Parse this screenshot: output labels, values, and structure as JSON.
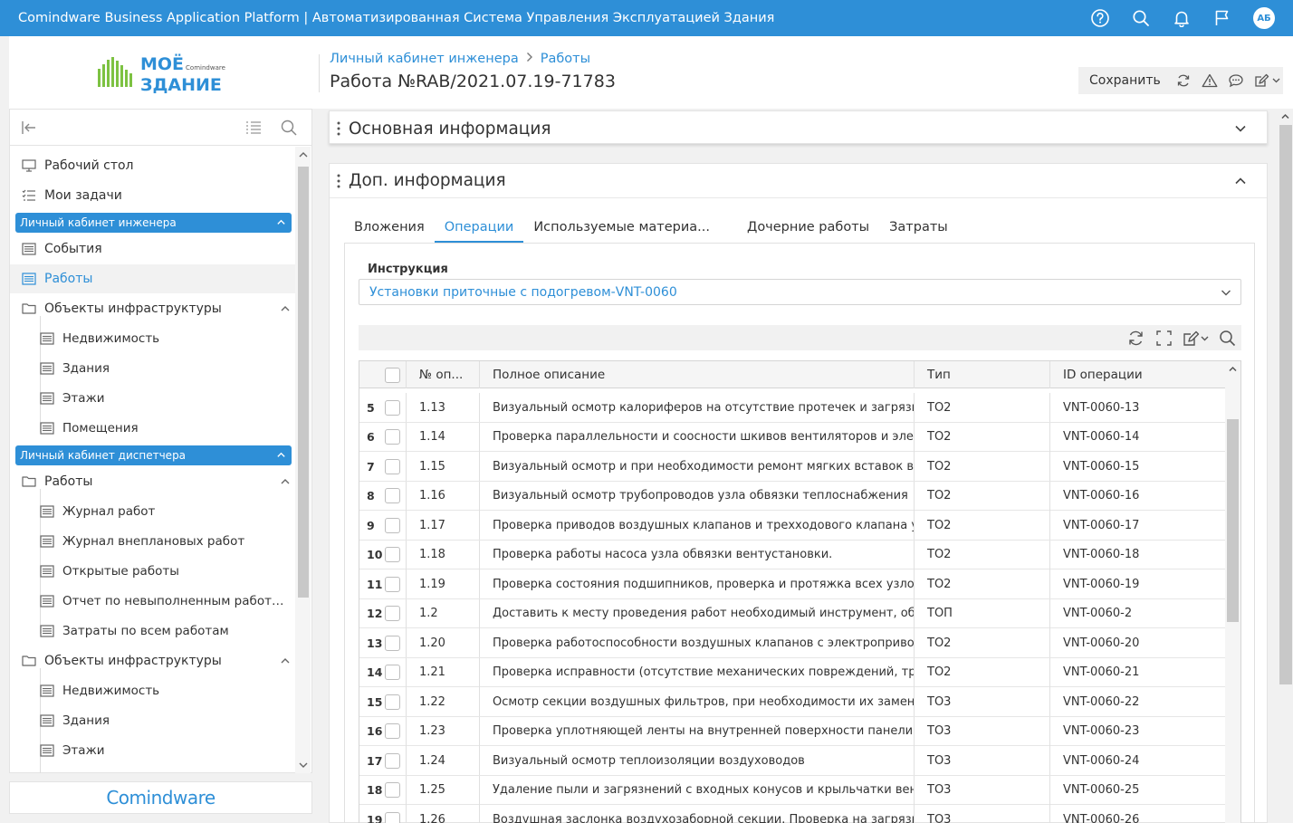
{
  "topbar": {
    "title": "Comindware Business Application Platform  |  Автоматизированная Система Управления Эксплуатацией Здания",
    "avatar_initials": "АБ",
    "icons": [
      "help-icon",
      "search-icon",
      "bell-icon",
      "flag-icon"
    ]
  },
  "logo": {
    "line1": "МОЁ",
    "line2": "ЗДАНИЕ",
    "small": "Comindware"
  },
  "header": {
    "breadcrumb": [
      "Личный кабинет инженера",
      "Работы"
    ],
    "title": "Работа №RAB/2021.07.19-71783",
    "save_label": "Сохранить"
  },
  "sidebar": {
    "items": [
      {
        "label": "Рабочий стол",
        "icon": "desktop-icon"
      },
      {
        "label": "Мои задачи",
        "icon": "tasks-icon"
      }
    ],
    "section1": {
      "title": "Личный кабинет инженера",
      "items": [
        {
          "label": "События",
          "icon": "list-icon"
        },
        {
          "label": "Работы",
          "icon": "list-icon"
        },
        {
          "label": "Объекты инфраструктуры",
          "icon": "folder-icon"
        },
        {
          "label": "Недвижимость",
          "icon": "list-icon"
        },
        {
          "label": "Здания",
          "icon": "list-icon"
        },
        {
          "label": "Этажи",
          "icon": "list-icon"
        },
        {
          "label": "Помещения",
          "icon": "list-icon"
        }
      ]
    },
    "section2": {
      "title": "Личный кабинет диспетчера",
      "items": [
        {
          "label": "Работы",
          "icon": "folder-icon"
        },
        {
          "label": "Журнал работ",
          "icon": "list-icon"
        },
        {
          "label": "Журнал внеплановых работ",
          "icon": "list-icon"
        },
        {
          "label": "Открытые работы",
          "icon": "list-icon"
        },
        {
          "label": "Отчет по невыполненным работ…",
          "icon": "list-icon"
        },
        {
          "label": "Затраты по всем работам",
          "icon": "list-icon"
        },
        {
          "label": "Объекты инфраструктуры",
          "icon": "folder-icon"
        },
        {
          "label": "Недвижимость",
          "icon": "list-icon"
        },
        {
          "label": "Здания",
          "icon": "list-icon"
        },
        {
          "label": "Этажи",
          "icon": "list-icon"
        }
      ]
    },
    "brand": "Comindware"
  },
  "panels": {
    "main_info": "Основная информация",
    "extra_info": "Доп. информация"
  },
  "tabs": [
    "Вложения",
    "Операции",
    "Используемые материа...",
    "Дочерние работы",
    "Затраты"
  ],
  "active_tab": "Операции",
  "instruction": {
    "label": "Инструкция",
    "value": "Установки приточные с подогревом-VNT-0060"
  },
  "grid": {
    "columns": {
      "op_no": "№ оп...",
      "description": "Полное описание",
      "type": "Тип",
      "op_id": "ID операции"
    },
    "rows": [
      {
        "n": "5",
        "op": "1.13",
        "desc": "Визуальный осмотр калориферов на отсутствие протечек и загрязне...",
        "type": "ТО2",
        "id": "VNT-0060-13"
      },
      {
        "n": "6",
        "op": "1.14",
        "desc": "Проверка параллельности и соосности шкивов вентиляторов и элек...",
        "type": "ТО2",
        "id": "VNT-0060-14"
      },
      {
        "n": "7",
        "op": "1.15",
        "desc": "Визуальный осмотр и при необходимости ремонт мягких вставок ве...",
        "type": "ТО2",
        "id": "VNT-0060-15"
      },
      {
        "n": "8",
        "op": "1.16",
        "desc": "Визуальный осмотр трубопроводов узла обвязки теплоснабжения",
        "type": "ТО2",
        "id": "VNT-0060-16"
      },
      {
        "n": "9",
        "op": "1.17",
        "desc": "Проверка приводов воздушных клапанов и трехходового клапана у...",
        "type": "ТО2",
        "id": "VNT-0060-17"
      },
      {
        "n": "10",
        "op": "1.18",
        "desc": "Проверка работы насоса узла обвязки вентустановки.",
        "type": "ТО2",
        "id": "VNT-0060-18"
      },
      {
        "n": "11",
        "op": "1.19",
        "desc": "Проверка состояния подшипников, проверка и протяжка всех узлов ...",
        "type": "ТО2",
        "id": "VNT-0060-19"
      },
      {
        "n": "12",
        "op": "1.2",
        "desc": "Доставить к месту проведения работ необходимый инструмент, обо...",
        "type": "ТОП",
        "id": "VNT-0060-2"
      },
      {
        "n": "13",
        "op": "1.20",
        "desc": "Проверка работоспособности воздушных клапанов с электропривод...",
        "type": "ТО2",
        "id": "VNT-0060-20"
      },
      {
        "n": "14",
        "op": "1.21",
        "desc": "Проверка исправности (отсутствие механических повреждений, тре...",
        "type": "ТО2",
        "id": "VNT-0060-21"
      },
      {
        "n": "15",
        "op": "1.22",
        "desc": "Осмотр секции воздушных фильтров, при необходимости их замена...",
        "type": "ТО3",
        "id": "VNT-0060-22"
      },
      {
        "n": "16",
        "op": "1.23",
        "desc": "Проверка уплотняющей ленты на внутренней поверхности панели с...",
        "type": "ТО3",
        "id": "VNT-0060-23"
      },
      {
        "n": "17",
        "op": "1.24",
        "desc": "Визуальный осмотр теплоизоляции воздуховодов",
        "type": "ТО3",
        "id": "VNT-0060-24"
      },
      {
        "n": "18",
        "op": "1.25",
        "desc": "Удаление пыли и загрязнений с входных конусов и крыльчатки вент...",
        "type": "ТО3",
        "id": "VNT-0060-25"
      },
      {
        "n": "19",
        "op": "1.26",
        "desc": "Воздушная заслонка воздухозаборной секции. Проверка на загрязн...",
        "type": "ТО3",
        "id": "VNT-0060-26"
      }
    ]
  },
  "colors": {
    "accent": "#2e8fd7",
    "logo_green": "#7dc242"
  }
}
